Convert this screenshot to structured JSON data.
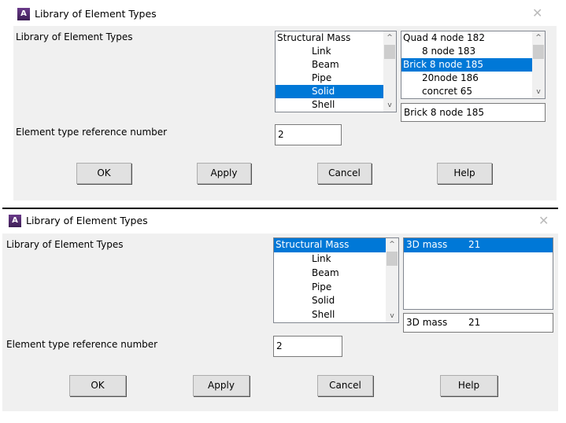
{
  "dialogs": [
    {
      "title": "Library of Element Types",
      "label_library": "Library of Element Types",
      "categories": [
        "Structural Mass",
        "Link",
        "Beam",
        "Pipe",
        "Solid",
        "Shell"
      ],
      "selected_category": "Solid",
      "elements": [
        "Quad  4 node 182",
        "8 node 183",
        "Brick 8 node 185",
        "20node 186",
        "concret 65"
      ],
      "selected_element": "Brick 8 node 185",
      "element_field": "Brick 8 node 185",
      "label_ref": "Element type reference number",
      "ref_value": "2",
      "buttons": {
        "ok": "OK",
        "apply": "Apply",
        "cancel": "Cancel",
        "help": "Help"
      }
    },
    {
      "title": "Library of Element Types",
      "label_library": "Library of Element Types",
      "categories": [
        "Structural Mass",
        "Link",
        "Beam",
        "Pipe",
        "Solid",
        "Shell"
      ],
      "selected_category": "Structural Mass",
      "elements": [
        "3D mass       21"
      ],
      "selected_element": "3D mass       21",
      "element_field": "3D mass       21",
      "label_ref": "Element type reference number",
      "ref_value": "2",
      "buttons": {
        "ok": "OK",
        "apply": "Apply",
        "cancel": "Cancel",
        "help": "Help"
      }
    }
  ],
  "icons": {
    "app": "A",
    "close": "✕",
    "scroll_up": "^",
    "scroll_down": "v"
  },
  "colors": {
    "selection": "#0078d7",
    "dialog_bg": "#f0f0f0"
  }
}
